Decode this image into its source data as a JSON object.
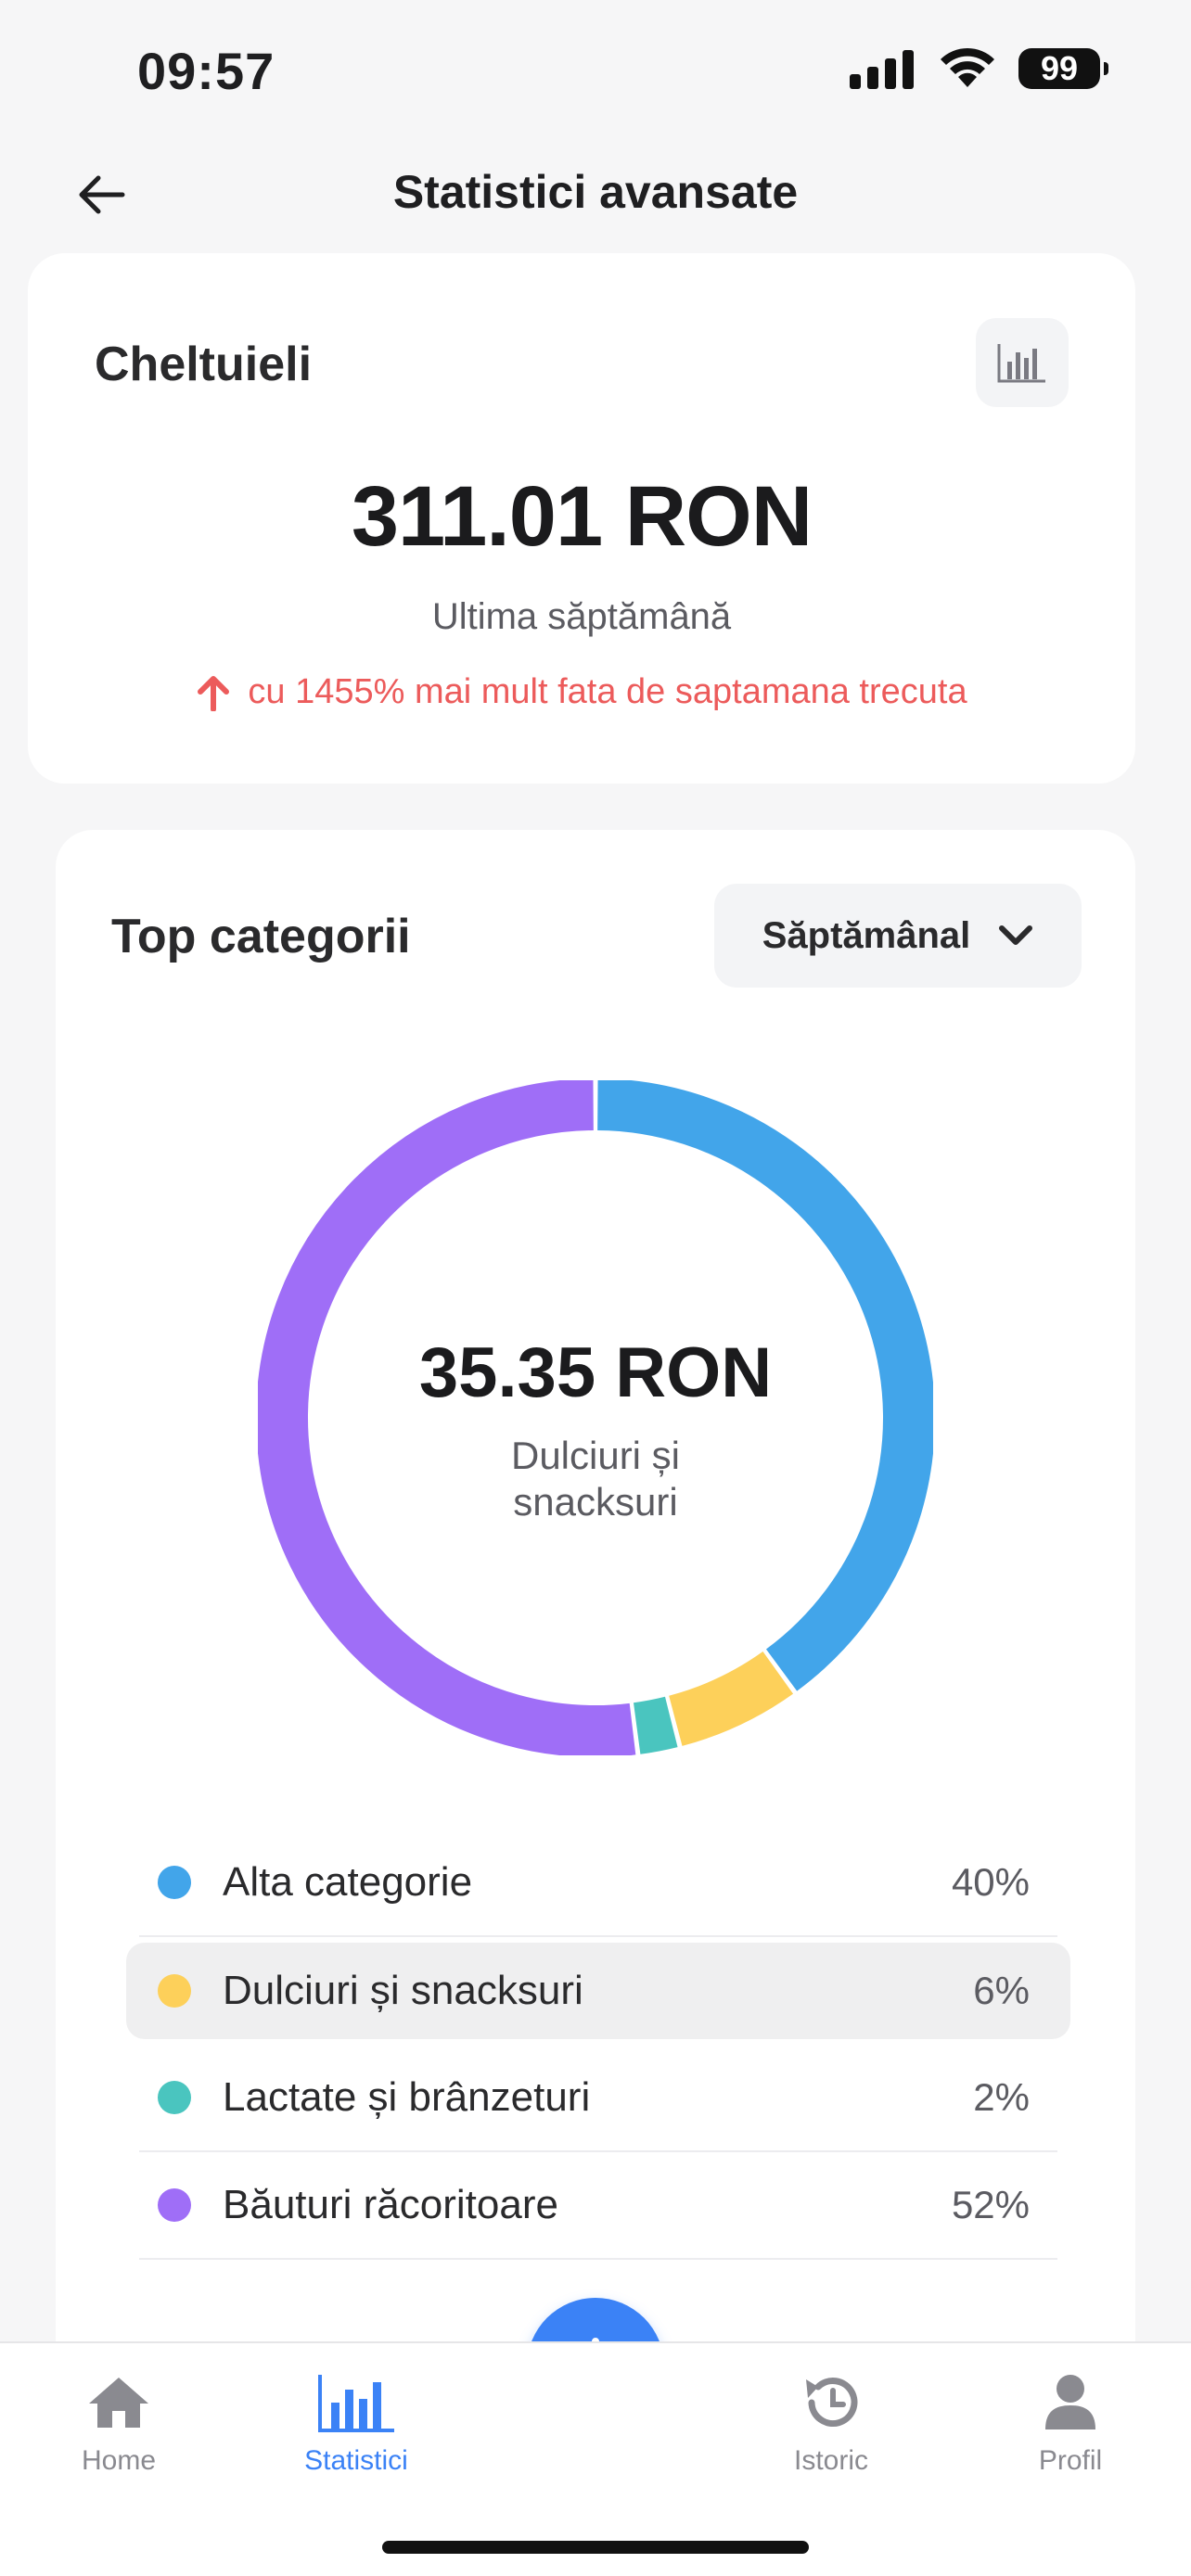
{
  "status_bar": {
    "time": "09:57",
    "battery": "99"
  },
  "header": {
    "title": "Statistici avansate"
  },
  "expenses": {
    "label": "Cheltuieli",
    "amount": "311.01 RON",
    "period": "Ultima săptămână",
    "change": "cu 1455% mai mult fata de saptamana trecuta",
    "change_color": "#ec5b5b"
  },
  "categories": {
    "title": "Top categorii",
    "period_select": "Săptămânal",
    "center_amount": "35.35 RON",
    "center_label": "Dulciuri și snacksuri",
    "items": [
      {
        "label": "Alta categorie",
        "percent": "40%",
        "value": 40,
        "color": "#42a5ea"
      },
      {
        "label": "Dulciuri și snacksuri",
        "percent": "6%",
        "value": 6,
        "color": "#fdd05a",
        "selected": true
      },
      {
        "label": "Lactate și brânzeturi",
        "percent": "2%",
        "value": 2,
        "color": "#4ac5bf"
      },
      {
        "label": "Băuturi răcoritoare",
        "percent": "52%",
        "value": 52,
        "color": "#9f6ef7"
      }
    ]
  },
  "tabbar": {
    "items": [
      {
        "label": "Home",
        "icon": "home-icon"
      },
      {
        "label": "Statistici",
        "icon": "bar-chart-icon",
        "active": true
      },
      {
        "label": "Istoric",
        "icon": "history-icon"
      },
      {
        "label": "Profil",
        "icon": "user-icon"
      }
    ],
    "fab_icon": "plus-icon",
    "accent": "#3b82f6"
  }
}
